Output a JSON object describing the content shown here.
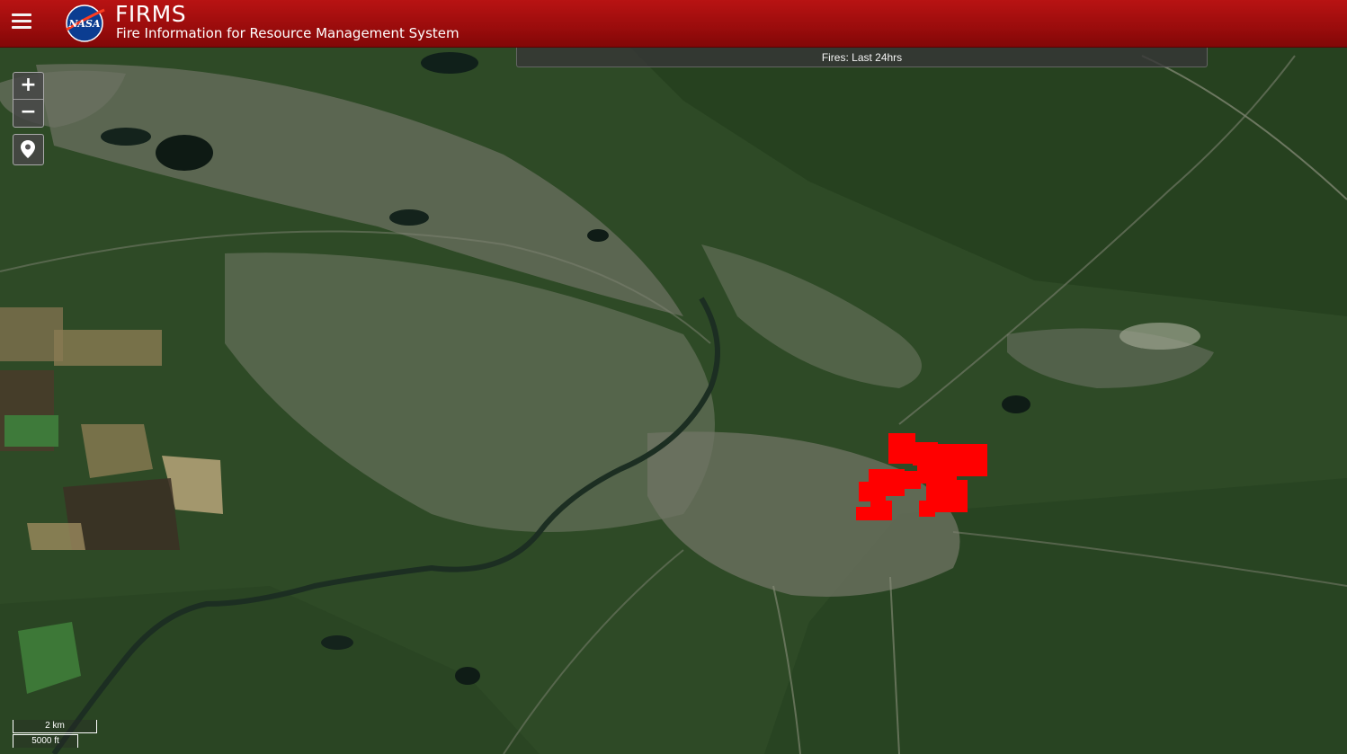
{
  "header": {
    "title": "FIRMS",
    "subtitle": "Fire Information for Resource Management System",
    "logo_text": "NASA",
    "menu_icon": "hamburger-menu-icon",
    "background_color": "#a50f0f"
  },
  "fires_bar": {
    "label": "Fires: Last 24hrs"
  },
  "map_controls": {
    "zoom_in_label": "+",
    "zoom_out_label": "−",
    "locate_icon": "map-pin-icon"
  },
  "scale": {
    "metric": "2 km",
    "imperial": "5000 ft"
  },
  "fire_marker_color": "#ff0000"
}
